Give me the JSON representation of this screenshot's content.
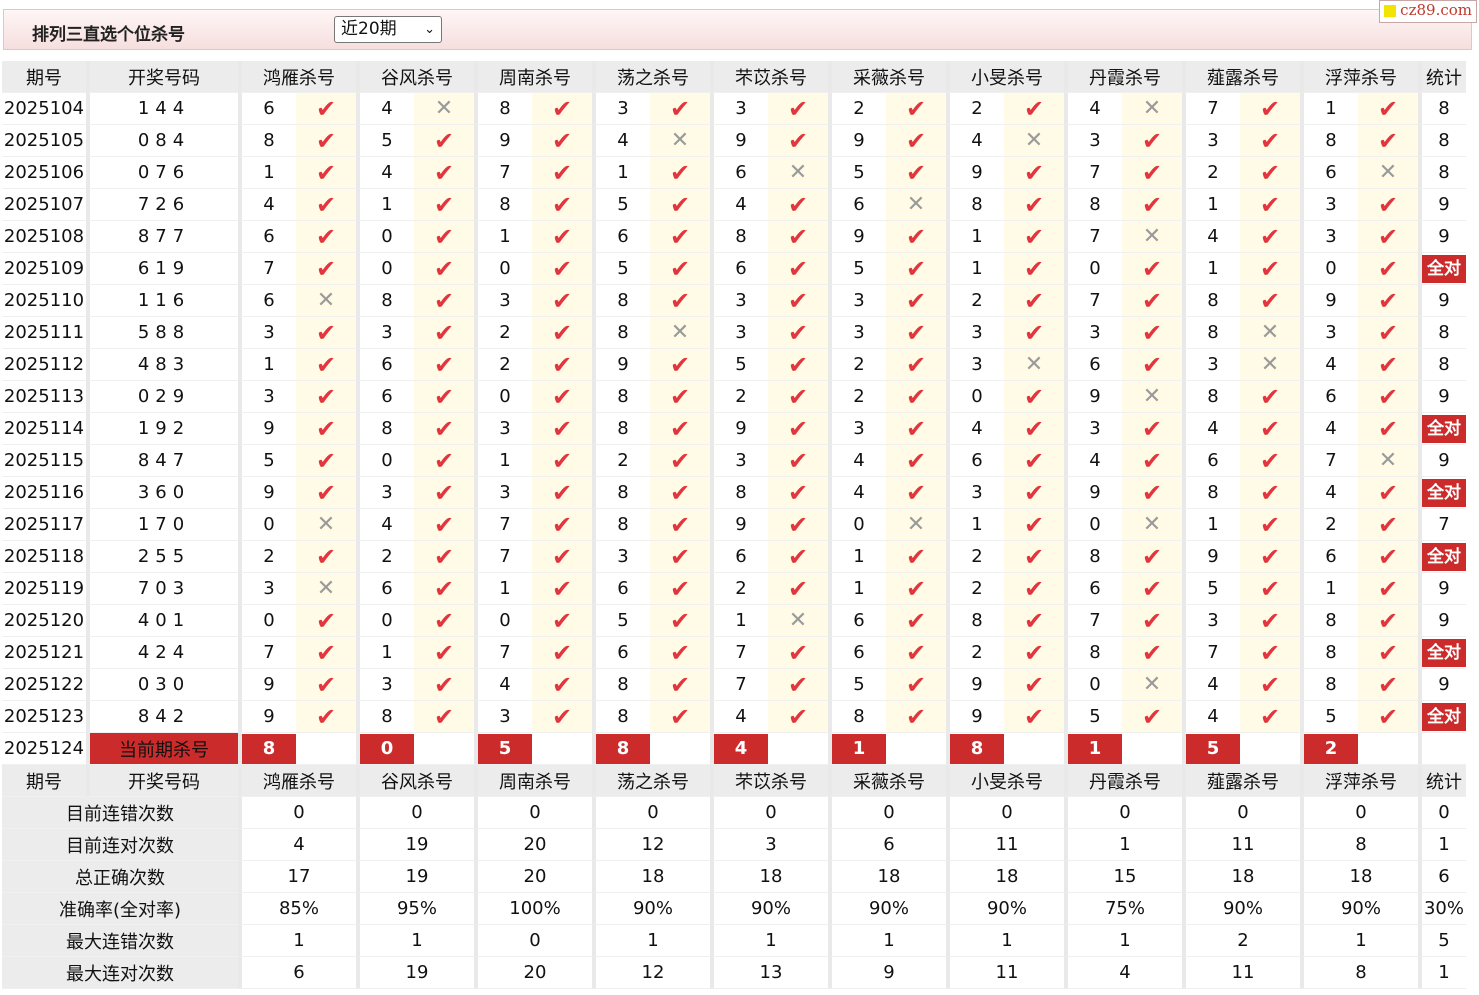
{
  "header": {
    "title": "排列三直选个位杀号",
    "period_select": "近20期",
    "logo_text": "cz89.com"
  },
  "table": {
    "col_period": "期号",
    "col_draw": "开奖号码",
    "killers": [
      "鸿雁杀号",
      "谷风杀号",
      "周南杀号",
      "荡之杀号",
      "芣苡杀号",
      "采薇杀号",
      "小旻杀号",
      "丹霞杀号",
      "薤露杀号",
      "浮萍杀号"
    ],
    "col_count": "统计",
    "all_correct_label": "全对",
    "rows": [
      {
        "period": "2025104",
        "draw": "144",
        "picks": [
          6,
          4,
          8,
          3,
          3,
          2,
          2,
          4,
          7,
          1
        ],
        "ok": [
          1,
          0,
          1,
          1,
          1,
          1,
          1,
          0,
          1,
          1
        ],
        "count": "8"
      },
      {
        "period": "2025105",
        "draw": "084",
        "picks": [
          8,
          5,
          9,
          4,
          9,
          9,
          4,
          3,
          3,
          8
        ],
        "ok": [
          1,
          1,
          1,
          0,
          1,
          1,
          0,
          1,
          1,
          1
        ],
        "count": "8"
      },
      {
        "period": "2025106",
        "draw": "076",
        "picks": [
          1,
          4,
          7,
          1,
          6,
          5,
          9,
          7,
          2,
          6
        ],
        "ok": [
          1,
          1,
          1,
          1,
          0,
          1,
          1,
          1,
          1,
          0
        ],
        "count": "8"
      },
      {
        "period": "2025107",
        "draw": "726",
        "picks": [
          4,
          1,
          8,
          5,
          4,
          6,
          8,
          8,
          1,
          3
        ],
        "ok": [
          1,
          1,
          1,
          1,
          1,
          0,
          1,
          1,
          1,
          1
        ],
        "count": "9"
      },
      {
        "period": "2025108",
        "draw": "877",
        "picks": [
          6,
          0,
          1,
          6,
          8,
          9,
          1,
          7,
          4,
          3
        ],
        "ok": [
          1,
          1,
          1,
          1,
          1,
          1,
          1,
          0,
          1,
          1
        ],
        "count": "9"
      },
      {
        "period": "2025109",
        "draw": "619",
        "picks": [
          7,
          0,
          0,
          5,
          6,
          5,
          1,
          0,
          1,
          0
        ],
        "ok": [
          1,
          1,
          1,
          1,
          1,
          1,
          1,
          1,
          1,
          1
        ],
        "count": "全对"
      },
      {
        "period": "2025110",
        "draw": "116",
        "picks": [
          6,
          8,
          3,
          8,
          3,
          3,
          2,
          7,
          8,
          9
        ],
        "ok": [
          0,
          1,
          1,
          1,
          1,
          1,
          1,
          1,
          1,
          1
        ],
        "count": "9"
      },
      {
        "period": "2025111",
        "draw": "588",
        "picks": [
          3,
          3,
          2,
          8,
          3,
          3,
          3,
          3,
          8,
          3
        ],
        "ok": [
          1,
          1,
          1,
          0,
          1,
          1,
          1,
          1,
          0,
          1
        ],
        "count": "8"
      },
      {
        "period": "2025112",
        "draw": "483",
        "picks": [
          1,
          6,
          2,
          9,
          5,
          2,
          3,
          6,
          3,
          4
        ],
        "ok": [
          1,
          1,
          1,
          1,
          1,
          1,
          0,
          1,
          0,
          1
        ],
        "count": "8"
      },
      {
        "period": "2025113",
        "draw": "029",
        "picks": [
          3,
          6,
          0,
          8,
          2,
          2,
          0,
          9,
          8,
          6
        ],
        "ok": [
          1,
          1,
          1,
          1,
          1,
          1,
          1,
          0,
          1,
          1
        ],
        "count": "9"
      },
      {
        "period": "2025114",
        "draw": "192",
        "picks": [
          9,
          8,
          3,
          8,
          9,
          3,
          4,
          3,
          4,
          4
        ],
        "ok": [
          1,
          1,
          1,
          1,
          1,
          1,
          1,
          1,
          1,
          1
        ],
        "count": "全对"
      },
      {
        "period": "2025115",
        "draw": "847",
        "picks": [
          5,
          0,
          1,
          2,
          3,
          4,
          6,
          4,
          6,
          7
        ],
        "ok": [
          1,
          1,
          1,
          1,
          1,
          1,
          1,
          1,
          1,
          0
        ],
        "count": "9"
      },
      {
        "period": "2025116",
        "draw": "360",
        "picks": [
          9,
          3,
          3,
          8,
          8,
          4,
          3,
          9,
          8,
          4
        ],
        "ok": [
          1,
          1,
          1,
          1,
          1,
          1,
          1,
          1,
          1,
          1
        ],
        "count": "全对"
      },
      {
        "period": "2025117",
        "draw": "170",
        "picks": [
          0,
          4,
          7,
          8,
          9,
          0,
          1,
          0,
          1,
          2
        ],
        "ok": [
          0,
          1,
          1,
          1,
          1,
          0,
          1,
          0,
          1,
          1
        ],
        "count": "7"
      },
      {
        "period": "2025118",
        "draw": "255",
        "picks": [
          2,
          2,
          7,
          3,
          6,
          1,
          2,
          8,
          9,
          6
        ],
        "ok": [
          1,
          1,
          1,
          1,
          1,
          1,
          1,
          1,
          1,
          1
        ],
        "count": "全对"
      },
      {
        "period": "2025119",
        "draw": "703",
        "picks": [
          3,
          6,
          1,
          6,
          2,
          1,
          2,
          6,
          5,
          1
        ],
        "ok": [
          0,
          1,
          1,
          1,
          1,
          1,
          1,
          1,
          1,
          1
        ],
        "count": "9"
      },
      {
        "period": "2025120",
        "draw": "401",
        "picks": [
          0,
          0,
          0,
          5,
          1,
          6,
          8,
          7,
          3,
          8
        ],
        "ok": [
          1,
          1,
          1,
          1,
          0,
          1,
          1,
          1,
          1,
          1
        ],
        "count": "9"
      },
      {
        "period": "2025121",
        "draw": "424",
        "picks": [
          7,
          1,
          7,
          6,
          7,
          6,
          2,
          8,
          7,
          8
        ],
        "ok": [
          1,
          1,
          1,
          1,
          1,
          1,
          1,
          1,
          1,
          1
        ],
        "count": "全对"
      },
      {
        "period": "2025122",
        "draw": "030",
        "picks": [
          9,
          3,
          4,
          8,
          7,
          5,
          9,
          0,
          4,
          8
        ],
        "ok": [
          1,
          1,
          1,
          1,
          1,
          1,
          1,
          0,
          1,
          1
        ],
        "count": "9"
      },
      {
        "period": "2025123",
        "draw": "842",
        "picks": [
          9,
          8,
          3,
          8,
          4,
          8,
          9,
          5,
          4,
          5
        ],
        "ok": [
          1,
          1,
          1,
          1,
          1,
          1,
          1,
          1,
          1,
          1
        ],
        "count": "全对"
      }
    ],
    "current": {
      "period": "2025124",
      "label": "当前期杀号",
      "picks": [
        8,
        0,
        5,
        8,
        4,
        1,
        8,
        1,
        5,
        2
      ]
    },
    "stats": [
      {
        "label": "目前连错次数",
        "values": [
          "0",
          "0",
          "0",
          "0",
          "0",
          "0",
          "0",
          "0",
          "0",
          "0"
        ],
        "total": "0",
        "red": false
      },
      {
        "label": "目前连对次数",
        "values": [
          "4",
          "19",
          "20",
          "12",
          "3",
          "6",
          "11",
          "1",
          "11",
          "8"
        ],
        "total": "1",
        "red": false
      },
      {
        "label": "总正确次数",
        "values": [
          "17",
          "19",
          "20",
          "18",
          "18",
          "18",
          "18",
          "15",
          "18",
          "18"
        ],
        "total": "6",
        "red": false
      },
      {
        "label": "准确率(全对率)",
        "values": [
          "85%",
          "95%",
          "100%",
          "90%",
          "90%",
          "90%",
          "90%",
          "75%",
          "90%",
          "90%"
        ],
        "total": "30%",
        "red": true
      },
      {
        "label": "最大连错次数",
        "values": [
          "1",
          "1",
          "0",
          "1",
          "1",
          "1",
          "1",
          "1",
          "2",
          "1"
        ],
        "total": "5",
        "red": false
      },
      {
        "label": "最大连对次数",
        "values": [
          "6",
          "19",
          "20",
          "12",
          "13",
          "9",
          "11",
          "4",
          "11",
          "8"
        ],
        "total": "1",
        "red": false
      }
    ]
  },
  "colors": {
    "accent_red": "#cc2b2b",
    "mark_red": "#e2363c",
    "stat_blue": "#1a29d8",
    "mark_bg": "#fffbe6"
  }
}
